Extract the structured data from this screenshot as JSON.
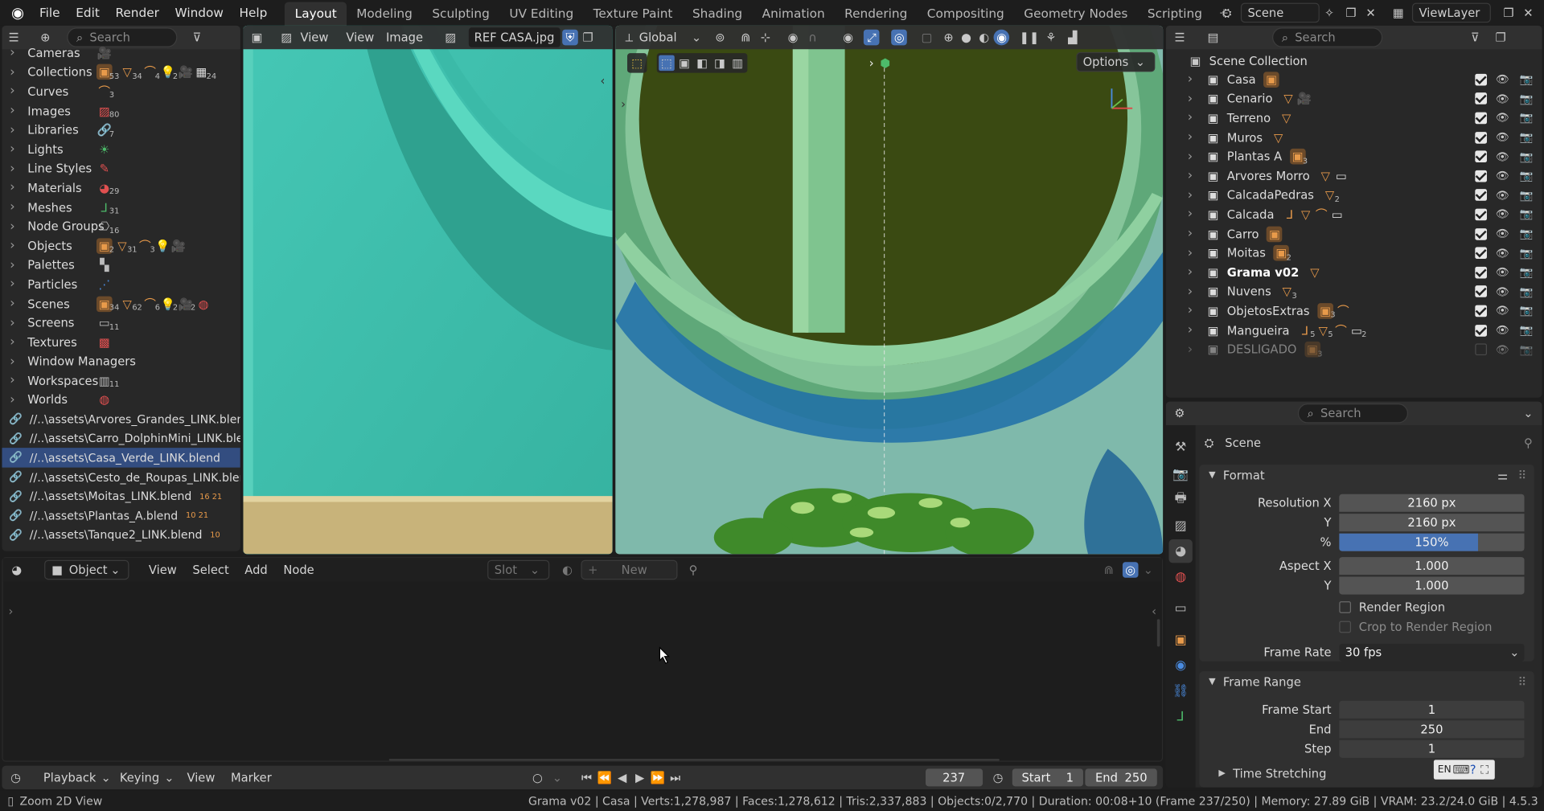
{
  "menubar": {
    "items": [
      "File",
      "Edit",
      "Render",
      "Window",
      "Help"
    ],
    "workspaces": [
      "Layout",
      "Modeling",
      "Sculpting",
      "UV Editing",
      "Texture Paint",
      "Shading",
      "Animation",
      "Rendering",
      "Compositing",
      "Geometry Nodes",
      "Scripting"
    ],
    "active_workspace": "Layout",
    "scene_label": "Scene",
    "view_layer_label": "ViewLayer"
  },
  "blend_browser": {
    "search_placeholder": "Search",
    "categories": [
      {
        "label": "Cameras",
        "icons": [
          "camera"
        ],
        "badges": [
          ""
        ]
      },
      {
        "label": "Collections",
        "icons": [
          "collection",
          "mesh",
          "curve",
          "light",
          "camera",
          "scene"
        ],
        "badges": [
          "53",
          "34",
          "4",
          "2",
          "",
          "24"
        ]
      },
      {
        "label": "Curves",
        "icons": [
          "curve"
        ],
        "badges": [
          "3"
        ]
      },
      {
        "label": "Images",
        "icons": [
          "image"
        ],
        "badges": [
          "80"
        ]
      },
      {
        "label": "Libraries",
        "icons": [
          "link"
        ],
        "badges": [
          "7"
        ]
      },
      {
        "label": "Lights",
        "icons": [
          "sun"
        ],
        "badges": [
          ""
        ]
      },
      {
        "label": "Line Styles",
        "icons": [
          "brush"
        ],
        "badges": [
          ""
        ]
      },
      {
        "label": "Materials",
        "icons": [
          "material"
        ],
        "badges": [
          "29"
        ]
      },
      {
        "label": "Meshes",
        "icons": [
          "mesh-data"
        ],
        "badges": [
          "31"
        ]
      },
      {
        "label": "Node Groups",
        "icons": [
          "nodes"
        ],
        "badges": [
          "16"
        ]
      },
      {
        "label": "Objects",
        "icons": [
          "collection",
          "mesh",
          "curve",
          "light",
          "camera"
        ],
        "badges": [
          "2",
          "31",
          "3",
          "",
          ""
        ]
      },
      {
        "label": "Palettes",
        "icons": [
          "palette"
        ],
        "badges": [
          ""
        ]
      },
      {
        "label": "Particles",
        "icons": [
          "particles"
        ],
        "badges": [
          ""
        ]
      },
      {
        "label": "Scenes",
        "icons": [
          "collection",
          "mesh",
          "curve",
          "light",
          "camera",
          "world"
        ],
        "badges": [
          "34",
          "62",
          "6",
          "2",
          "2",
          ""
        ]
      },
      {
        "label": "Screens",
        "icons": [
          "screen"
        ],
        "badges": [
          "11"
        ]
      },
      {
        "label": "Textures",
        "icons": [
          "texture"
        ],
        "badges": [
          ""
        ]
      },
      {
        "label": "Window Managers",
        "icons": [],
        "badges": []
      },
      {
        "label": "Workspaces",
        "icons": [
          "workspace"
        ],
        "badges": [
          "11"
        ]
      },
      {
        "label": "Worlds",
        "icons": [
          "world"
        ],
        "badges": [
          ""
        ]
      }
    ],
    "libraries": [
      {
        "label": "//..\\assets\\Arvores_Grandes_LINK.blend",
        "extra": ""
      },
      {
        "label": "//..\\assets\\Carro_DolphinMini_LINK.blend",
        "extra": ""
      },
      {
        "label": "//..\\assets\\Casa_Verde_LINK.blend",
        "extra": "",
        "selected": true
      },
      {
        "label": "//..\\assets\\Cesto_de_Roupas_LINK.blend",
        "extra": ""
      },
      {
        "label": "//..\\assets\\Moitas_LINK.blend",
        "extra": "16  21"
      },
      {
        "label": "//..\\assets\\Plantas_A.blend",
        "extra": "10  21"
      },
      {
        "label": "//..\\assets\\Tanque2_LINK.blend",
        "extra": "10"
      }
    ]
  },
  "image_editor": {
    "view_label": "View",
    "menu_view": "View",
    "menu_image": "Image",
    "image_name": "REF CASA.jpg"
  },
  "viewport": {
    "orientation": "Global",
    "options_label": "Options"
  },
  "outliner": {
    "search_placeholder": "Search",
    "root": "Scene Collection",
    "items": [
      {
        "label": "Casa",
        "icons": [
          "collection"
        ],
        "badges": [
          ""
        ],
        "dim": false
      },
      {
        "label": "Cenario",
        "icons": [
          "mesh",
          "camera"
        ],
        "badges": [
          "",
          ""
        ],
        "dim": false
      },
      {
        "label": "Terreno",
        "icons": [
          "mesh"
        ],
        "badges": [
          ""
        ],
        "dim": false
      },
      {
        "label": "Muros",
        "icons": [
          "mesh"
        ],
        "badges": [
          ""
        ],
        "dim": false
      },
      {
        "label": "Plantas A",
        "icons": [
          "collection"
        ],
        "badges": [
          "3"
        ],
        "dim": false
      },
      {
        "label": "Arvores Morro",
        "icons": [
          "mesh",
          "box"
        ],
        "badges": [
          "",
          ""
        ],
        "dim": false
      },
      {
        "label": "CalcadaPedras",
        "icons": [
          "mesh"
        ],
        "badges": [
          "2"
        ],
        "dim": false
      },
      {
        "label": "Calcada",
        "icons": [
          "empty",
          "mesh",
          "curve",
          "box"
        ],
        "badges": [
          "",
          "",
          "",
          ""
        ],
        "dim": false
      },
      {
        "label": "Carro",
        "icons": [
          "collection"
        ],
        "badges": [
          ""
        ],
        "dim": false
      },
      {
        "label": "Moitas",
        "icons": [
          "collection"
        ],
        "badges": [
          "2"
        ],
        "dim": false
      },
      {
        "label": "Grama v02",
        "icons": [
          "mesh"
        ],
        "badges": [
          ""
        ],
        "dim": false,
        "bold": true
      },
      {
        "label": "Nuvens",
        "icons": [
          "mesh"
        ],
        "badges": [
          "3"
        ],
        "dim": false
      },
      {
        "label": "ObjetosExtras",
        "icons": [
          "collection",
          "curve"
        ],
        "badges": [
          "3",
          ""
        ],
        "dim": false
      },
      {
        "label": "Mangueira",
        "icons": [
          "empty",
          "mesh",
          "curve",
          "box"
        ],
        "badges": [
          "5",
          "5",
          "",
          "2"
        ],
        "dim": false
      },
      {
        "label": "DESLIGADO",
        "icons": [
          "collection"
        ],
        "badges": [
          "3"
        ],
        "dim": true
      }
    ]
  },
  "properties": {
    "search_placeholder": "Search",
    "context": "Scene",
    "format_title": "Format",
    "res_x_label": "Resolution X",
    "res_x": "2160 px",
    "res_y_label": "Y",
    "res_y": "2160 px",
    "res_pct_label": "%",
    "res_pct": "150%",
    "res_pct_fill": 0.75,
    "aspect_x_label": "Aspect X",
    "aspect_x": "1.000",
    "aspect_y_label": "Y",
    "aspect_y": "1.000",
    "render_region": "Render Region",
    "crop_region": "Crop to Render Region",
    "frame_rate_label": "Frame Rate",
    "frame_rate": "30 fps",
    "frame_range_title": "Frame Range",
    "frame_start_label": "Frame Start",
    "frame_start": "1",
    "end_label": "End",
    "end": "250",
    "step_label": "Step",
    "step": "1",
    "time_stretching": "Time Stretching",
    "lang_indicator": "EN"
  },
  "shader_editor": {
    "mode": "Object",
    "menus": [
      "View",
      "Select",
      "Add",
      "Node"
    ],
    "slot": "Slot",
    "new_label": "New"
  },
  "timeline": {
    "menus": [
      "Playback",
      "Keying",
      "View",
      "Marker"
    ],
    "current_frame": "237",
    "start_label": "Start",
    "start": "1",
    "end_label": "End",
    "end": "250"
  },
  "statusbar": {
    "left": "Zoom 2D View",
    "right": "Grama v02 | Casa | Verts:1,278,987 | Faces:1,278,612 | Tris:2,337,883 | Objects:0/2,770 | Duration: 00:08+10 (Frame 237/250) | Memory: 27.89 GiB | VRAM: 23.2/24.0 GiB | 4.5.3"
  },
  "colors": {
    "accent": "#4772b3",
    "selection": "#334d80",
    "orange": "#e89a4a",
    "wall_teal": "#3fc0ad",
    "render_green": "#4f8a2f"
  }
}
